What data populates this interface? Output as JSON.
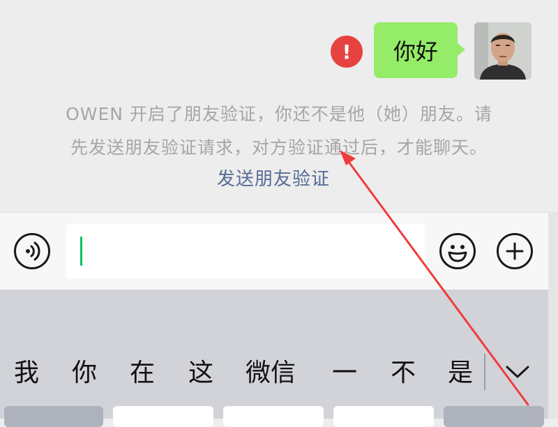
{
  "chat": {
    "message": {
      "text": "你好",
      "status": "send-failed",
      "icon": "exclamation-icon"
    },
    "avatar": {
      "icon": "user-avatar"
    },
    "notice_lines": [
      "OWEN 开启了朋友验证，你还不是他（她）朋友。请",
      "先发送朋友验证请求，对方验证通过后，才能聊天。"
    ],
    "send_verification_link": "发送朋友验证"
  },
  "input_bar": {
    "voice_icon": "voice-icon",
    "text_value": "",
    "emoji_icon": "emoji-icon",
    "plus_icon": "plus-icon"
  },
  "keyboard": {
    "candidates": [
      "我",
      "你",
      "在",
      "这",
      "微信",
      "一",
      "不",
      "是"
    ],
    "collapse_icon": "chevron-down-icon"
  },
  "colors": {
    "bubble": "#95ec69",
    "error": "#e64340",
    "link": "#576b95",
    "caret": "#07c160",
    "annotation_arrow": "#f03c3c"
  }
}
